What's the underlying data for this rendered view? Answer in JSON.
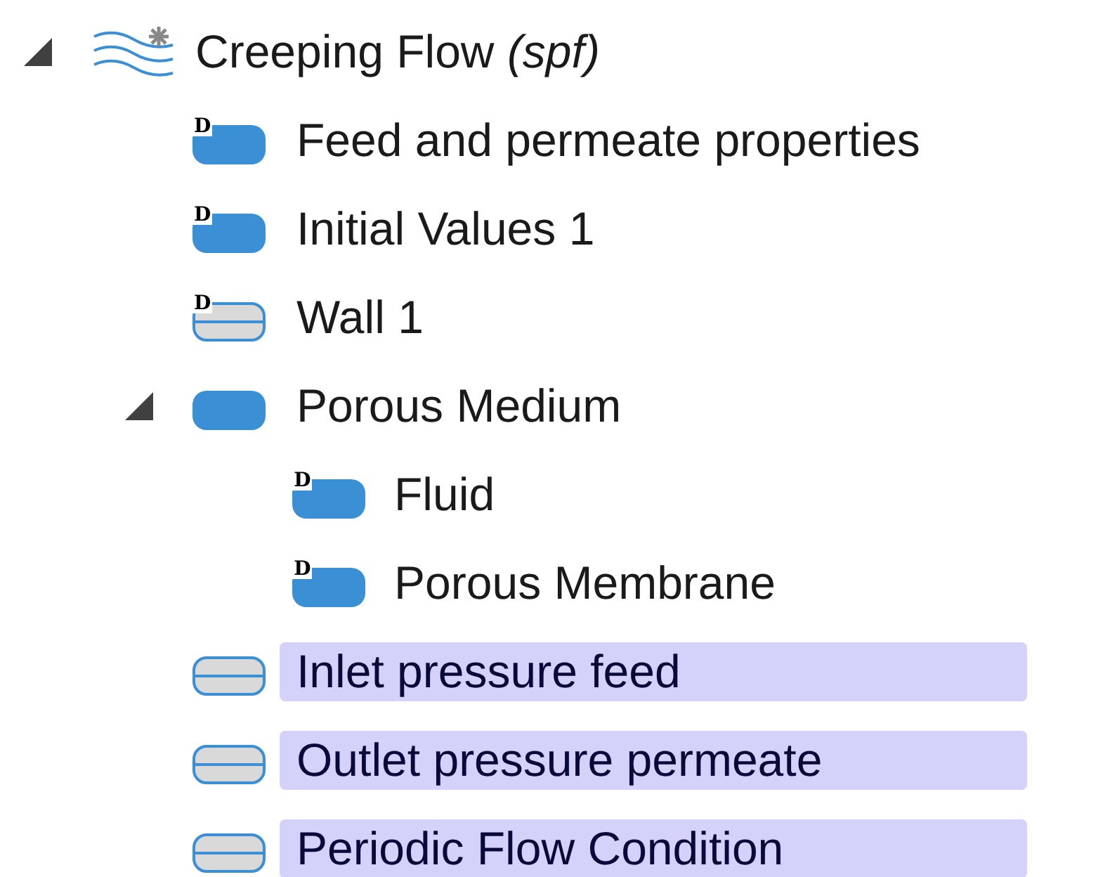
{
  "tree": [
    {
      "label": "Creeping Flow *(spf)*",
      "kind": "physics",
      "selected": false,
      "expanded": true,
      "children": [
        {
          "label": "Feed and permeate properties",
          "kind": "domain",
          "badge": "D",
          "selected": false
        },
        {
          "label": "Initial Values 1",
          "kind": "domain",
          "badge": "D",
          "selected": false
        },
        {
          "label": "Wall 1",
          "kind": "boundary",
          "badge": "D",
          "selected": false
        },
        {
          "label": "Porous Medium",
          "kind": "domain",
          "selected": false,
          "expanded": true,
          "children": [
            {
              "label": "Fluid",
              "kind": "domain",
              "badge": "D",
              "selected": false
            },
            {
              "label": "Porous Membrane",
              "kind": "domain",
              "badge": "D",
              "selected": false
            }
          ]
        },
        {
          "label": "Inlet pressure feed",
          "kind": "boundary",
          "selected": true
        },
        {
          "label": "Outlet pressure permeate",
          "kind": "boundary",
          "selected": true
        },
        {
          "label": "Periodic Flow Condition",
          "kind": "boundary",
          "selected": true
        }
      ]
    }
  ]
}
